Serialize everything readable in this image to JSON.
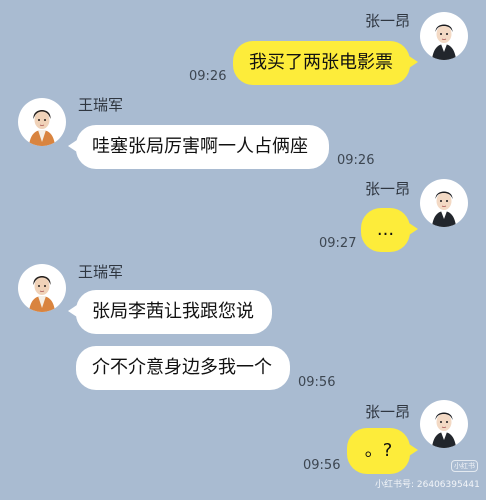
{
  "messages": [
    {
      "sender": "张一昂",
      "text": "我买了两张电影票",
      "time": "09:26"
    },
    {
      "sender": "王瑞军",
      "text": "哇塞张局厉害啊一人占俩座",
      "time": "09:26"
    },
    {
      "sender": "张一昂",
      "text": "...",
      "time": "09:27"
    },
    {
      "sender": "王瑞军",
      "text": "张局李茜让我跟您说",
      "time": ""
    },
    {
      "sender": "王瑞军",
      "text": "介不介意身边多我一个",
      "time": "09:56"
    },
    {
      "sender": "张一昂",
      "text": "。?",
      "time": "09:56"
    }
  ],
  "watermark": {
    "badge": "小红书",
    "text": "小红书号: 26406395441"
  },
  "colors": {
    "background": "#a9bbd1",
    "outgoing_bubble": "#fdec3a",
    "incoming_bubble": "#ffffff"
  },
  "icons": {
    "outgoing_avatar": "man-in-suit-avatar-icon",
    "incoming_avatar": "man-in-orange-jacket-avatar-icon"
  }
}
